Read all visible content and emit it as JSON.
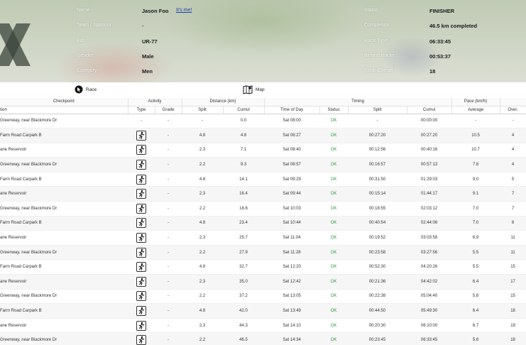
{
  "athlete": {
    "name_label": "Name",
    "name": "Jason Foo",
    "its_me_link": "It's me!",
    "team_label": "Team / Sponsor",
    "team": "-",
    "bib_label": "Bib",
    "bib": "UR-77",
    "gender_label": "Gender",
    "gender": "Male",
    "category_label": "Category",
    "category": "Men",
    "status_label": "Status",
    "status": "FINISHER",
    "completion_label": "Completion",
    "completion": "46.5 km completed",
    "race_time_label": "Race Time",
    "race_time": "06:33:45",
    "behind_label": "Behind leader",
    "behind": "00:53:37",
    "rank_label": "Rank Overall",
    "rank": "18"
  },
  "links": {
    "race": "Race",
    "map": "Map"
  },
  "table": {
    "groups": {
      "checkpoint": "Checkpoint",
      "activity": "Activity",
      "distance": "Distance (km)",
      "timing": "Timing",
      "pace": "Pace (km/h)"
    },
    "columns": {
      "location": "tion",
      "type": "Type",
      "grade": "Grade",
      "split": "Split",
      "cumul": "Cumul",
      "time_of_day": "Time of Day",
      "status": "Status",
      "t_split": "Split",
      "t_cumul": "Cumul",
      "average": "Average",
      "over": "Over."
    },
    "rows": [
      {
        "loc": "Greenway, near Blackmore Dr",
        "type": "-",
        "grade": "-",
        "split": "-",
        "cumul": "0.0",
        "tod": "Sat 08:00",
        "status": "OK",
        "tsplit": "-",
        "tcumul": "00:00:00",
        "avg": "-",
        "over": "-"
      },
      {
        "loc": " Farm Road Carpark B",
        "type": "run",
        "grade": "-",
        "split": "4.8",
        "cumul": "4.8",
        "tod": "Sat 08:27",
        "status": "OK",
        "tsplit": "00:27:20",
        "tcumul": "00:27:20",
        "avg": "10.5",
        "over": "4"
      },
      {
        "loc": "ane Reservoir",
        "type": "run",
        "grade": "-",
        "split": "2.3",
        "cumul": "7.1",
        "tod": "Sat 08:40",
        "status": "OK",
        "tsplit": "00:12:56",
        "tcumul": "00:40:16",
        "avg": "10.7",
        "over": "4"
      },
      {
        "loc": "Greenway, near Blackmore Dr",
        "type": "run",
        "grade": "-",
        "split": "2.2",
        "cumul": "9.3",
        "tod": "Sat 08:57",
        "status": "OK",
        "tsplit": "00:16:57",
        "tcumul": "00:57:13",
        "avg": "7.8",
        "over": "4"
      },
      {
        "loc": " Farm Road Carpark B",
        "type": "run",
        "grade": "-",
        "split": "4.8",
        "cumul": "14.1",
        "tod": "Sat 09:29",
        "status": "OK",
        "tsplit": "00:31:50",
        "tcumul": "01:29:03",
        "avg": "9.0",
        "over": "5"
      },
      {
        "loc": "ane Reservoir",
        "type": "run",
        "grade": "-",
        "split": "2.3",
        "cumul": "16.4",
        "tod": "Sat 09:44",
        "status": "OK",
        "tsplit": "00:15:14",
        "tcumul": "01:44:17",
        "avg": "9.1",
        "over": "7"
      },
      {
        "loc": "Greenway, near Blackmore Dr",
        "type": "run",
        "grade": "-",
        "split": "2.2",
        "cumul": "18.6",
        "tod": "Sat 10:03",
        "status": "OK",
        "tsplit": "00:18:55",
        "tcumul": "02:03:12",
        "avg": "7.0",
        "over": "7"
      },
      {
        "loc": " Farm Road Carpark B",
        "type": "run",
        "grade": "-",
        "split": "4.8",
        "cumul": "23.4",
        "tod": "Sat 10:44",
        "status": "OK",
        "tsplit": "00:40:54",
        "tcumul": "02:44:06",
        "avg": "7.0",
        "over": "8"
      },
      {
        "loc": "ane Reservoir",
        "type": "run",
        "grade": "-",
        "split": "2.3",
        "cumul": "25.7",
        "tod": "Sat 11:04",
        "status": "OK",
        "tsplit": "00:19:52",
        "tcumul": "03:03:58",
        "avg": "6.9",
        "over": "11"
      },
      {
        "loc": "Greenway, near Blackmore Dr",
        "type": "run",
        "grade": "-",
        "split": "2.2",
        "cumul": "27.9",
        "tod": "Sat 11:28",
        "status": "OK",
        "tsplit": "00:23:58",
        "tcumul": "03:27:56",
        "avg": "5.5",
        "over": "11"
      },
      {
        "loc": " Farm Road Carpark B",
        "type": "run",
        "grade": "-",
        "split": "4.8",
        "cumul": "32.7",
        "tod": "Sat 12:20",
        "status": "OK",
        "tsplit": "00:52:30",
        "tcumul": "04:20:26",
        "avg": "5.5",
        "over": "15"
      },
      {
        "loc": "ane Reservoir",
        "type": "run",
        "grade": "-",
        "split": "2.3",
        "cumul": "35.0",
        "tod": "Sat 12:42",
        "status": "OK",
        "tsplit": "00:21:36",
        "tcumul": "04:42:02",
        "avg": "6.4",
        "over": "17"
      },
      {
        "loc": "Greenway, near Blackmore Dr",
        "type": "run",
        "grade": "-",
        "split": "2.2",
        "cumul": "37.2",
        "tod": "Sat 13:05",
        "status": "OK",
        "tsplit": "00:22:38",
        "tcumul": "05:04:40",
        "avg": "5.8",
        "over": "15"
      },
      {
        "loc": " Farm Road Carpark B",
        "type": "run",
        "grade": "-",
        "split": "4.8",
        "cumul": "42.0",
        "tod": "Sat 13:49",
        "status": "OK",
        "tsplit": "00:44:50",
        "tcumul": "05:49:30",
        "avg": "6.4",
        "over": "18"
      },
      {
        "loc": "ane Reservoir",
        "type": "run",
        "grade": "-",
        "split": "2.3",
        "cumul": "44.3",
        "tod": "Sat 14:10",
        "status": "OK",
        "tsplit": "00:20:30",
        "tcumul": "06:10:00",
        "avg": "6.7",
        "over": "19"
      },
      {
        "loc": "Greenway, near Blackmore Dr",
        "type": "run",
        "grade": "-",
        "split": "2.2",
        "cumul": "46.5",
        "tod": "Sat 14:34",
        "status": "OK",
        "tsplit": "00:23:45",
        "tcumul": "06:33:45",
        "avg": "5.6",
        "over": "18"
      }
    ]
  }
}
